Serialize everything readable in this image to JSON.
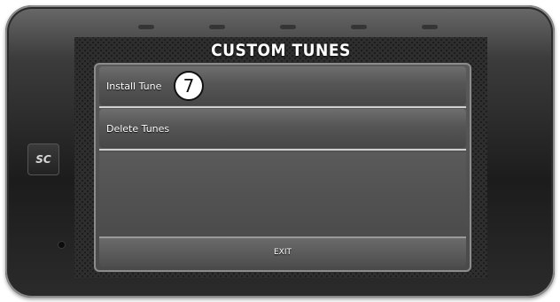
{
  "device": {
    "brand_logo_text": "SC"
  },
  "screen": {
    "title": "CUSTOM TUNES",
    "menu_items": [
      {
        "label": "Install Tune"
      },
      {
        "label": "Delete Tunes"
      }
    ],
    "exit_label": "EXIT"
  },
  "annotation": {
    "step_number": "7"
  },
  "colors": {
    "bezel": "#1c1c1c",
    "screen_bg": "#141414",
    "menu_item": "#555555",
    "divider": "#cfcfcf",
    "text": "#ffffff"
  }
}
